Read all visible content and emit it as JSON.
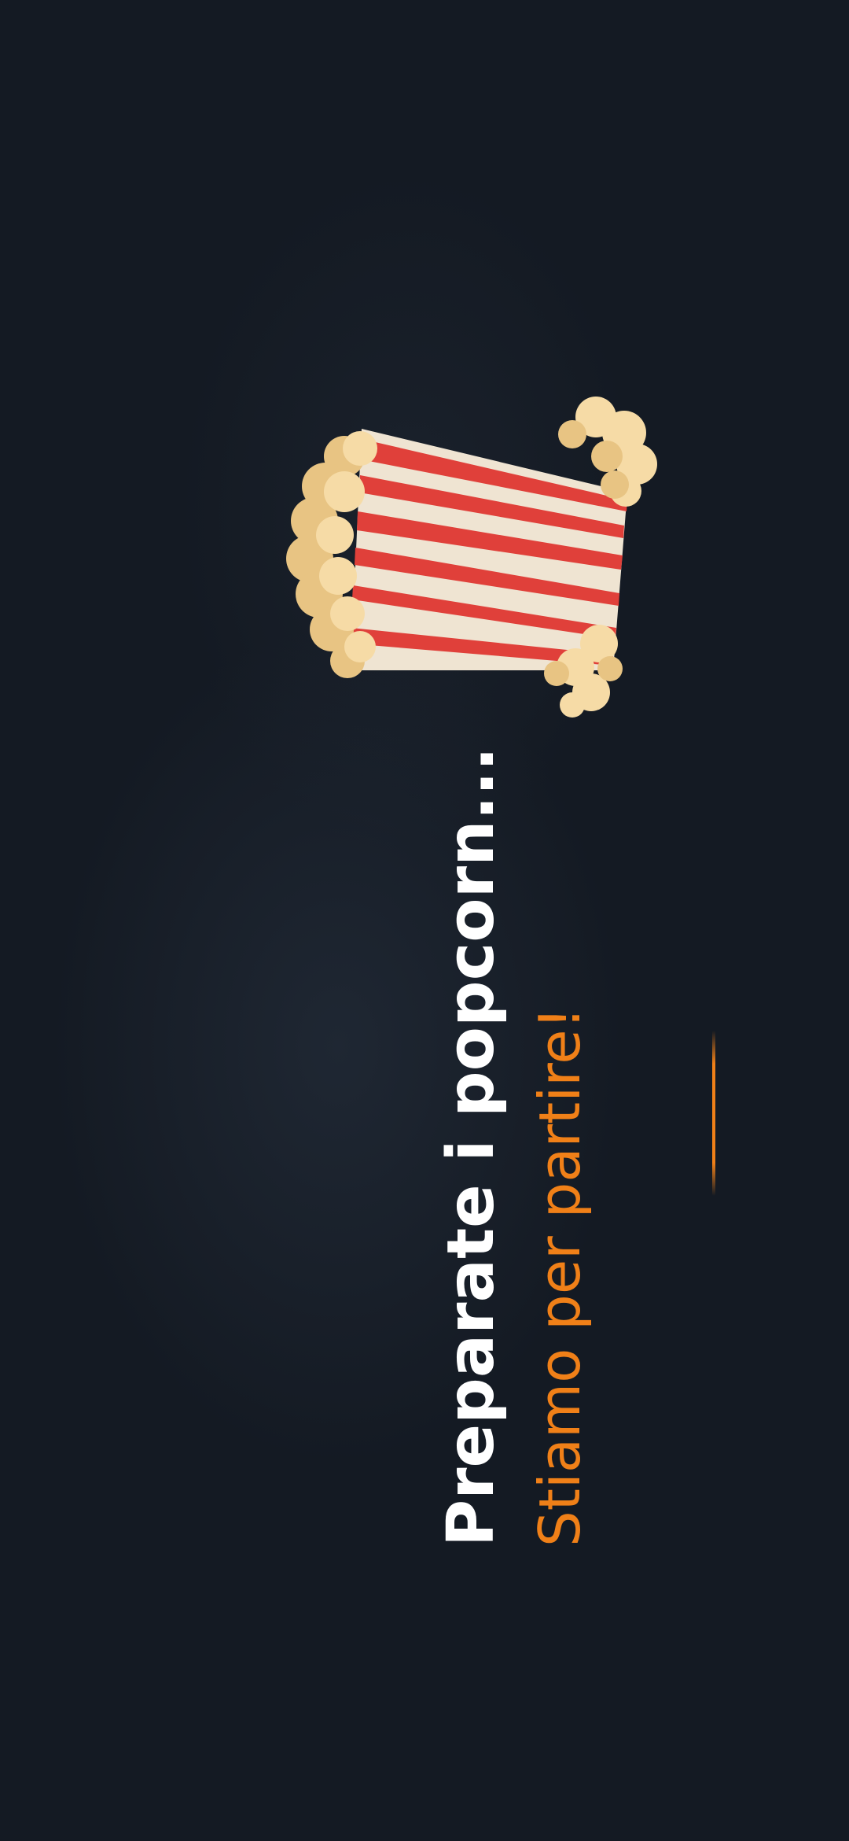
{
  "loading_screen": {
    "title": "Preparate i popcorn...",
    "subtitle": "Stiamo per partire!",
    "icon": "popcorn-bucket-icon"
  },
  "colors": {
    "background": "#141a23",
    "title": "#ffffff",
    "accent": "#f08018",
    "stripe_red": "#e0403a",
    "stripe_cream": "#efe4d2",
    "popcorn": "#f4d9a0"
  }
}
